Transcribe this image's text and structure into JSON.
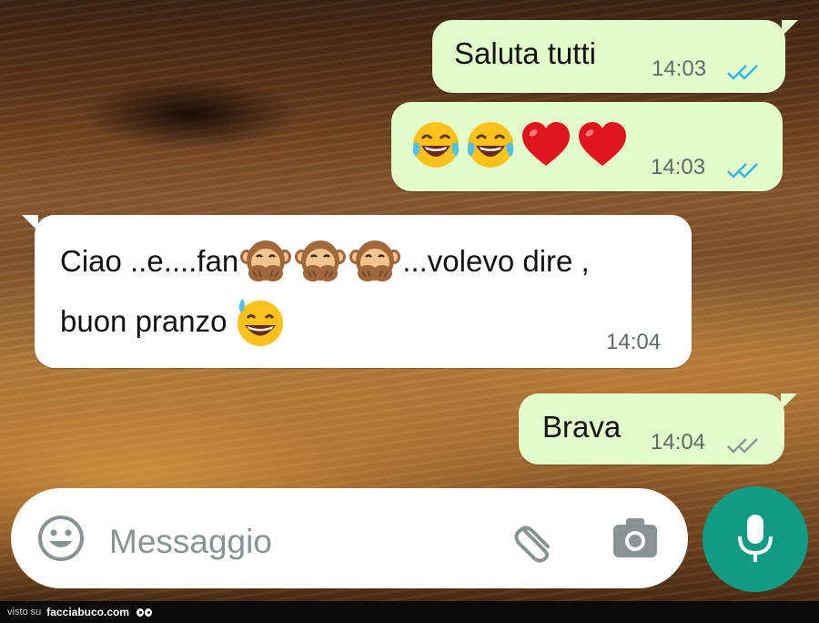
{
  "wallpaper": {
    "description_color": "#7a4a25"
  },
  "messages": [
    {
      "direction": "outgoing",
      "text": "Saluta tutti",
      "time": "14:03",
      "status": "read"
    },
    {
      "direction": "outgoing",
      "emojis": [
        "face-with-tears-of-joy",
        "face-with-tears-of-joy",
        "red-heart",
        "red-heart"
      ],
      "time": "14:03",
      "status": "read"
    },
    {
      "direction": "incoming",
      "line1_part1": "Ciao ..e....fan",
      "line1_emojis": [
        "speak-no-evil-monkey",
        "speak-no-evil-monkey",
        "speak-no-evil-monkey"
      ],
      "line1_part2": "...volevo dire ,",
      "line2": "buon pranzo",
      "line2_emoji": "grinning-face-with-sweat",
      "time": "14:04"
    },
    {
      "direction": "outgoing",
      "text": "Brava",
      "time": "14:04",
      "status": "delivered"
    }
  ],
  "composer": {
    "placeholder": "Messaggio",
    "emoji_icon": "smiley-icon",
    "attach_icon": "paperclip-icon",
    "camera_icon": "camera-icon",
    "mic_icon": "microphone-icon"
  },
  "footer": {
    "visto": "visto su",
    "site": "facciabuco.com"
  },
  "colors": {
    "outgoing_bubble": "#e2fdc9",
    "incoming_bubble": "#ffffff",
    "read_ticks": "#34b7f1",
    "sent_ticks": "#8c9699",
    "mic_button": "#109c84"
  }
}
